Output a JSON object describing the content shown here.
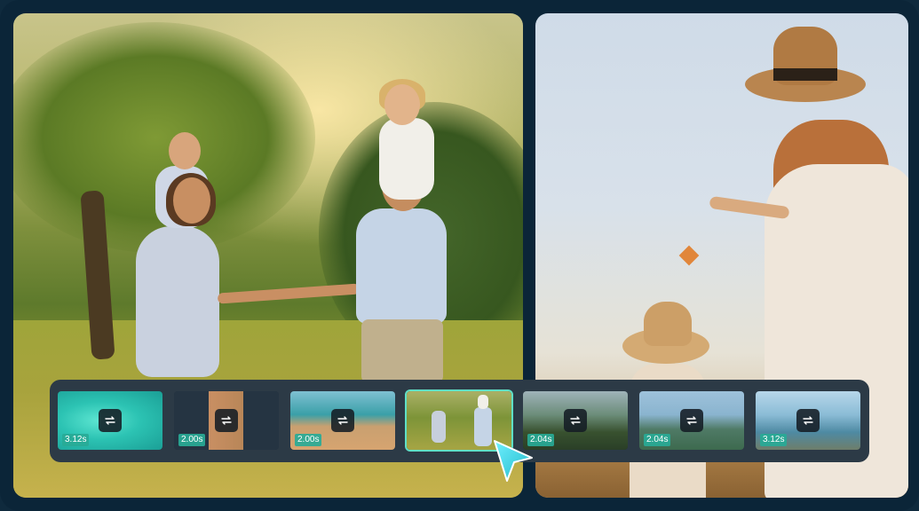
{
  "timeline": {
    "clips": [
      {
        "duration": "3.12s",
        "icon": "swap-icon",
        "selected": false
      },
      {
        "duration": "2.00s",
        "icon": "swap-icon",
        "selected": false
      },
      {
        "duration": "2.00s",
        "icon": "swap-icon",
        "selected": false
      },
      {
        "duration": "",
        "icon": "swap-icon",
        "selected": true
      },
      {
        "duration": "2.04s",
        "icon": "swap-icon",
        "selected": false
      },
      {
        "duration": "2.04s",
        "icon": "swap-icon",
        "selected": false
      },
      {
        "duration": "3.12s",
        "icon": "swap-icon",
        "selected": false
      }
    ]
  },
  "colors": {
    "background": "#0b2538",
    "timeline": "#2c3a46",
    "accent": "#5fe0c6",
    "badge": "#28aa96"
  }
}
